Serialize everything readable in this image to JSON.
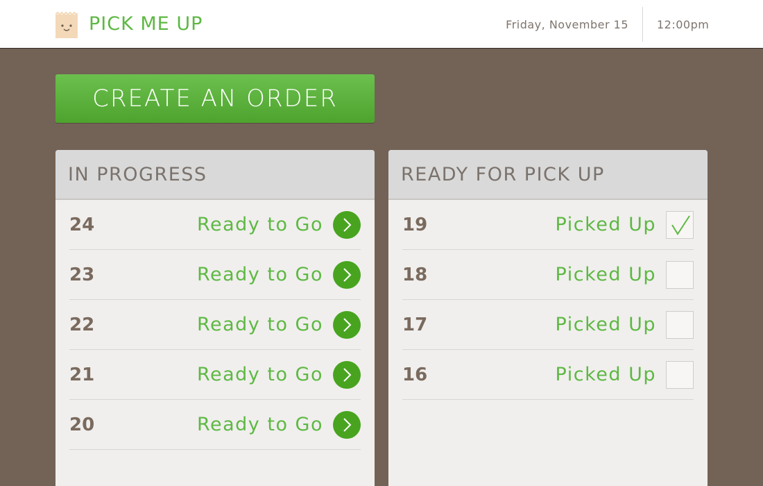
{
  "header": {
    "brand": "PICK ME UP",
    "logo_icon": "paper-bag-face-icon",
    "date": "Friday, November 15",
    "time": "12:00pm"
  },
  "create_button": {
    "label": "CREATE AN ORDER"
  },
  "in_progress": {
    "title": "IN PROGRESS",
    "orders": [
      {
        "number": "24",
        "status": "Ready to Go"
      },
      {
        "number": "23",
        "status": "Ready to Go"
      },
      {
        "number": "22",
        "status": "Ready to Go"
      },
      {
        "number": "21",
        "status": "Ready to Go"
      },
      {
        "number": "20",
        "status": "Ready to Go"
      }
    ]
  },
  "ready_for_pickup": {
    "title": "READY FOR PICK UP",
    "orders": [
      {
        "number": "19",
        "status": "Picked Up",
        "checked": true
      },
      {
        "number": "18",
        "status": "Picked Up",
        "checked": false
      },
      {
        "number": "17",
        "status": "Picked Up",
        "checked": false
      },
      {
        "number": "16",
        "status": "Picked Up",
        "checked": false
      }
    ]
  },
  "colors": {
    "accent_green": "#5eb843",
    "button_green": "#48a41f",
    "background_brown": "#736256"
  }
}
